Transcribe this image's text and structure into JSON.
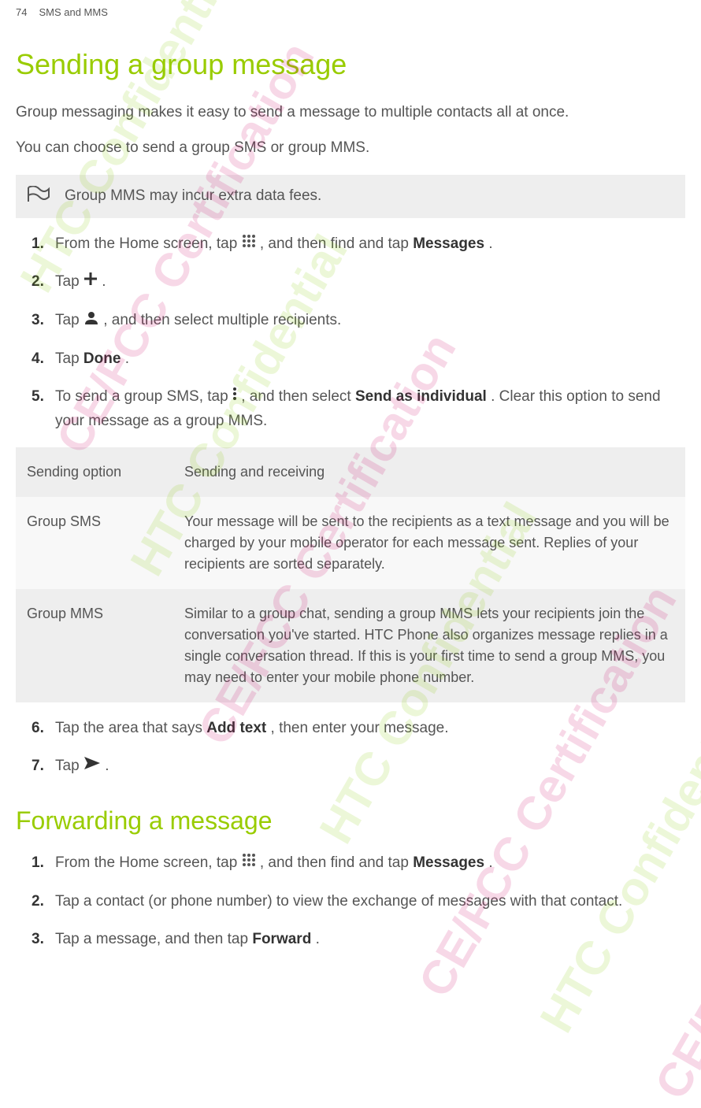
{
  "header": {
    "page_number": "74",
    "section": "SMS and MMS"
  },
  "sections": {
    "sending_group": {
      "title": "Sending a group message",
      "intro1": "Group messaging makes it easy to send a message to multiple contacts all at once.",
      "intro2": " You can choose to send a group SMS or group MMS.",
      "note": "Group MMS may incur extra data fees.",
      "steps": {
        "s1_a": "From the Home screen, tap ",
        "s1_b": ", and then find and tap ",
        "s1_c": "Messages",
        "s1_d": ".",
        "s2_a": "Tap ",
        "s2_b": ".",
        "s3_a": "Tap ",
        "s3_b": ", and then select multiple recipients.",
        "s4_a": "Tap ",
        "s4_b": "Done",
        "s4_c": ".",
        "s5_a": "To send a group SMS, tap  ",
        "s5_b": " , and then select ",
        "s5_c": "Send as individual",
        "s5_d": ". Clear this option to send your message as a group MMS."
      },
      "table": {
        "header1": "Sending option",
        "header2": "Sending and receiving",
        "row1_col1": "Group SMS",
        "row1_col2": "Your message will be sent to the recipients as a text message and you will be charged by your mobile operator for each message sent. Replies of your recipients are sorted separately.",
        "row2_col1": "Group MMS",
        "row2_col2": "Similar to a group chat, sending a group MMS lets your recipients join the conversation you've started. HTC Phone also organizes message replies in a single conversation thread. If this is your first time to send a group MMS, you may need to enter your mobile phone number."
      },
      "steps_after": {
        "s6_a": "Tap the area that says ",
        "s6_b": "Add text",
        "s6_c": ", then enter your message.",
        "s7_a": "Tap ",
        "s7_b": "."
      }
    },
    "forwarding": {
      "title": "Forwarding a message",
      "steps": {
        "s1_a": "From the Home screen, tap ",
        "s1_b": ", and then find and tap ",
        "s1_c": "Messages",
        "s1_d": ".",
        "s2_a": "Tap a contact (or phone number) to view the exchange of messages with that contact.",
        "s3_a": "Tap a message, and then tap ",
        "s3_b": "Forward",
        "s3_c": "."
      }
    }
  },
  "watermarks": {
    "htc": "HTC Confidential",
    "cefcc": "CE/FCC Certification"
  }
}
